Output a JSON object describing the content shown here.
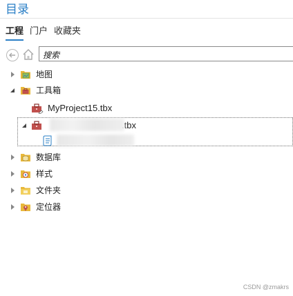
{
  "pane": {
    "title": "目录"
  },
  "tabs": [
    {
      "label": "工程",
      "active": true
    },
    {
      "label": "门户",
      "active": false
    },
    {
      "label": "收藏夹",
      "active": false
    }
  ],
  "toolbar": {
    "search_placeholder": "搜索"
  },
  "tree": {
    "maps": {
      "label": "地图",
      "icon": "map-folder-icon",
      "expanded": false
    },
    "toolboxes": {
      "label": "工具箱",
      "icon": "toolbox-folder-icon",
      "expanded": true
    },
    "toolbox_1": {
      "label": "MyProject15.tbx",
      "icon": "toolbox-icon"
    },
    "toolbox_2": {
      "label_suffix": ".tbx",
      "icon": "toolbox-icon",
      "expanded": true
    },
    "toolbox_2_child": {
      "icon": "script-tool-icon"
    },
    "databases": {
      "label": "数据库",
      "icon": "database-folder-icon",
      "expanded": false
    },
    "styles": {
      "label": "样式",
      "icon": "style-folder-icon",
      "expanded": false
    },
    "folders": {
      "label": "文件夹",
      "icon": "folder-icon",
      "expanded": false
    },
    "locators": {
      "label": "定位器",
      "icon": "locator-folder-icon",
      "expanded": false
    }
  },
  "watermark": "CSDN @zmakrs",
  "colors": {
    "accent": "#2a7fc6",
    "folder": "#e8b83a",
    "toolbox": "#c0504d"
  }
}
